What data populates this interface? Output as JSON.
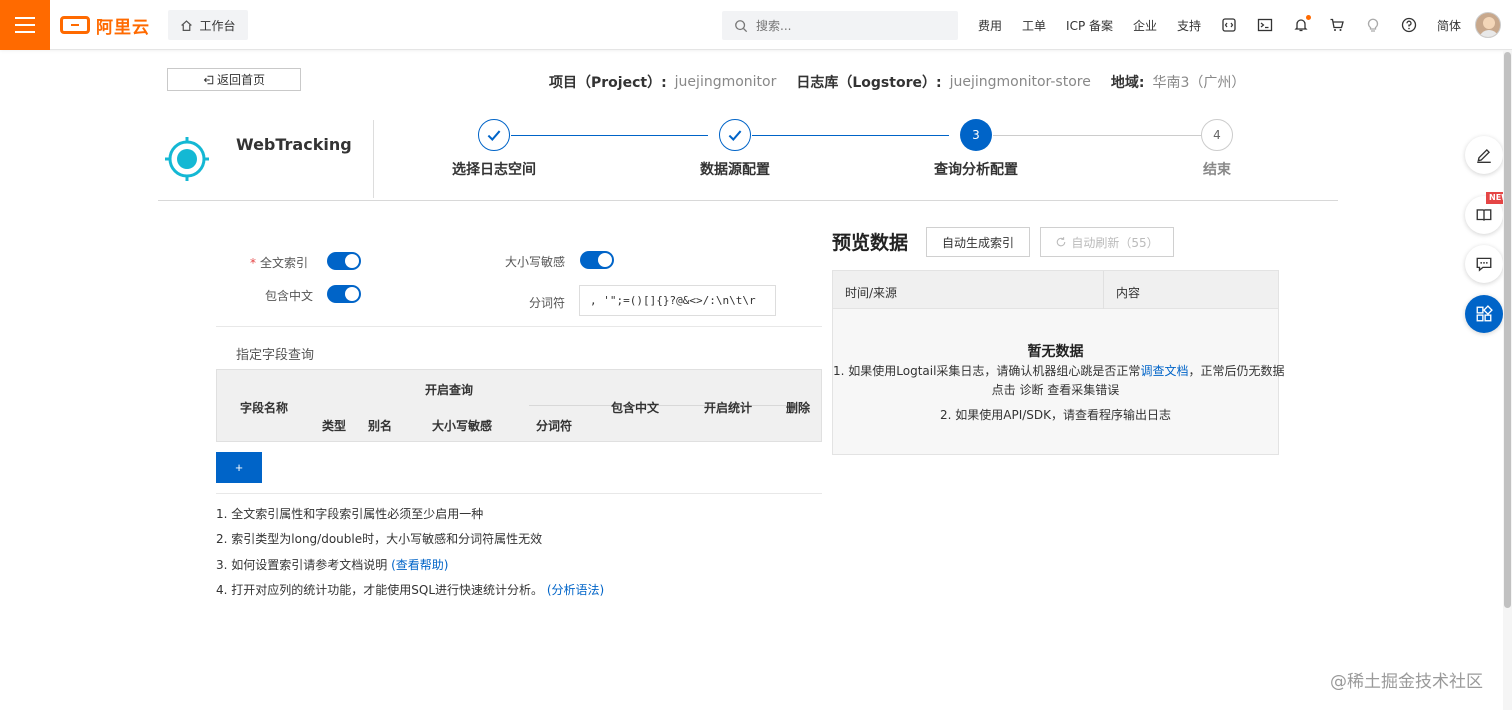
{
  "topbar": {
    "logo_text": "阿里云",
    "workbench": "工作台",
    "search_placeholder": "搜索...",
    "links": [
      "费用",
      "工单",
      "ICP 备案",
      "企业",
      "支持"
    ],
    "language": "简体"
  },
  "back_button": "返回首页",
  "project_info": {
    "project_label": "项目（Project）:",
    "project_value": "juejingmonitor",
    "logstore_label": "日志库（Logstore）:",
    "logstore_value": "juejingmonitor-store",
    "region_label": "地域:",
    "region_value": "华南3（广州）"
  },
  "header": {
    "title": "WebTracking",
    "steps": [
      {
        "num": "1",
        "label": "选择日志空间",
        "state": "done"
      },
      {
        "num": "2",
        "label": "数据源配置",
        "state": "done"
      },
      {
        "num": "3",
        "label": "查询分析配置",
        "state": "active"
      },
      {
        "num": "4",
        "label": "结束",
        "state": "todo"
      }
    ]
  },
  "index_settings": {
    "full_text_index": "全文索引",
    "include_chinese": "包含中文",
    "case_sensitive": "大小写敏感",
    "tokenizer_label": "分词符",
    "tokenizer_value": ", '\";=()[]{}?@&<>/:\\n\\t\\r",
    "toggles": {
      "full_text_index": true,
      "include_chinese": true,
      "case_sensitive": true
    }
  },
  "field_query": {
    "title": "指定字段查询",
    "headers": {
      "field_name": "字段名称",
      "enable_query": "开启查询",
      "type": "类型",
      "alias": "别名",
      "case_sensitive": "大小写敏感",
      "tokenizer": "分词符",
      "include_chinese": "包含中文",
      "enable_stats": "开启统计",
      "delete": "删除"
    },
    "add_button": "+"
  },
  "notes": [
    {
      "text": "1. 全文索引属性和字段索引属性必须至少启用一种",
      "link": ""
    },
    {
      "text": "2. 索引类型为long/double时，大小写敏感和分词符属性无效",
      "link": ""
    },
    {
      "text": "3. 如何设置索引请参考文档说明",
      "link": "(查看帮助)"
    },
    {
      "text": "4. 打开对应列的统计功能，才能使用SQL进行快速统计分析。",
      "link": "(分析语法)"
    }
  ],
  "preview": {
    "title": "预览数据",
    "auto_index_button": "自动生成索引",
    "auto_refresh_button": "自动刷新（55）",
    "col_time": "时间/来源",
    "col_content": "内容",
    "empty_title": "暂无数据",
    "empty_line1_pre": "1. 如果使用Logtail采集日志，请确认机器组心跳是否正常",
    "empty_line1_link": "调查文档",
    "empty_line1_post": "，正常后仍无数据",
    "empty_line2": "点击 诊断 查看采集错误",
    "empty_line3": "2. 如果使用API/SDK，请查看程序输出日志"
  },
  "float_toolbar": {
    "new_badge": "NEW"
  },
  "watermark": "@稀土掘金技术社区",
  "colors": {
    "brand": "#ff6a00",
    "primary": "#0064c8",
    "target_icon": "#14b8d4"
  }
}
